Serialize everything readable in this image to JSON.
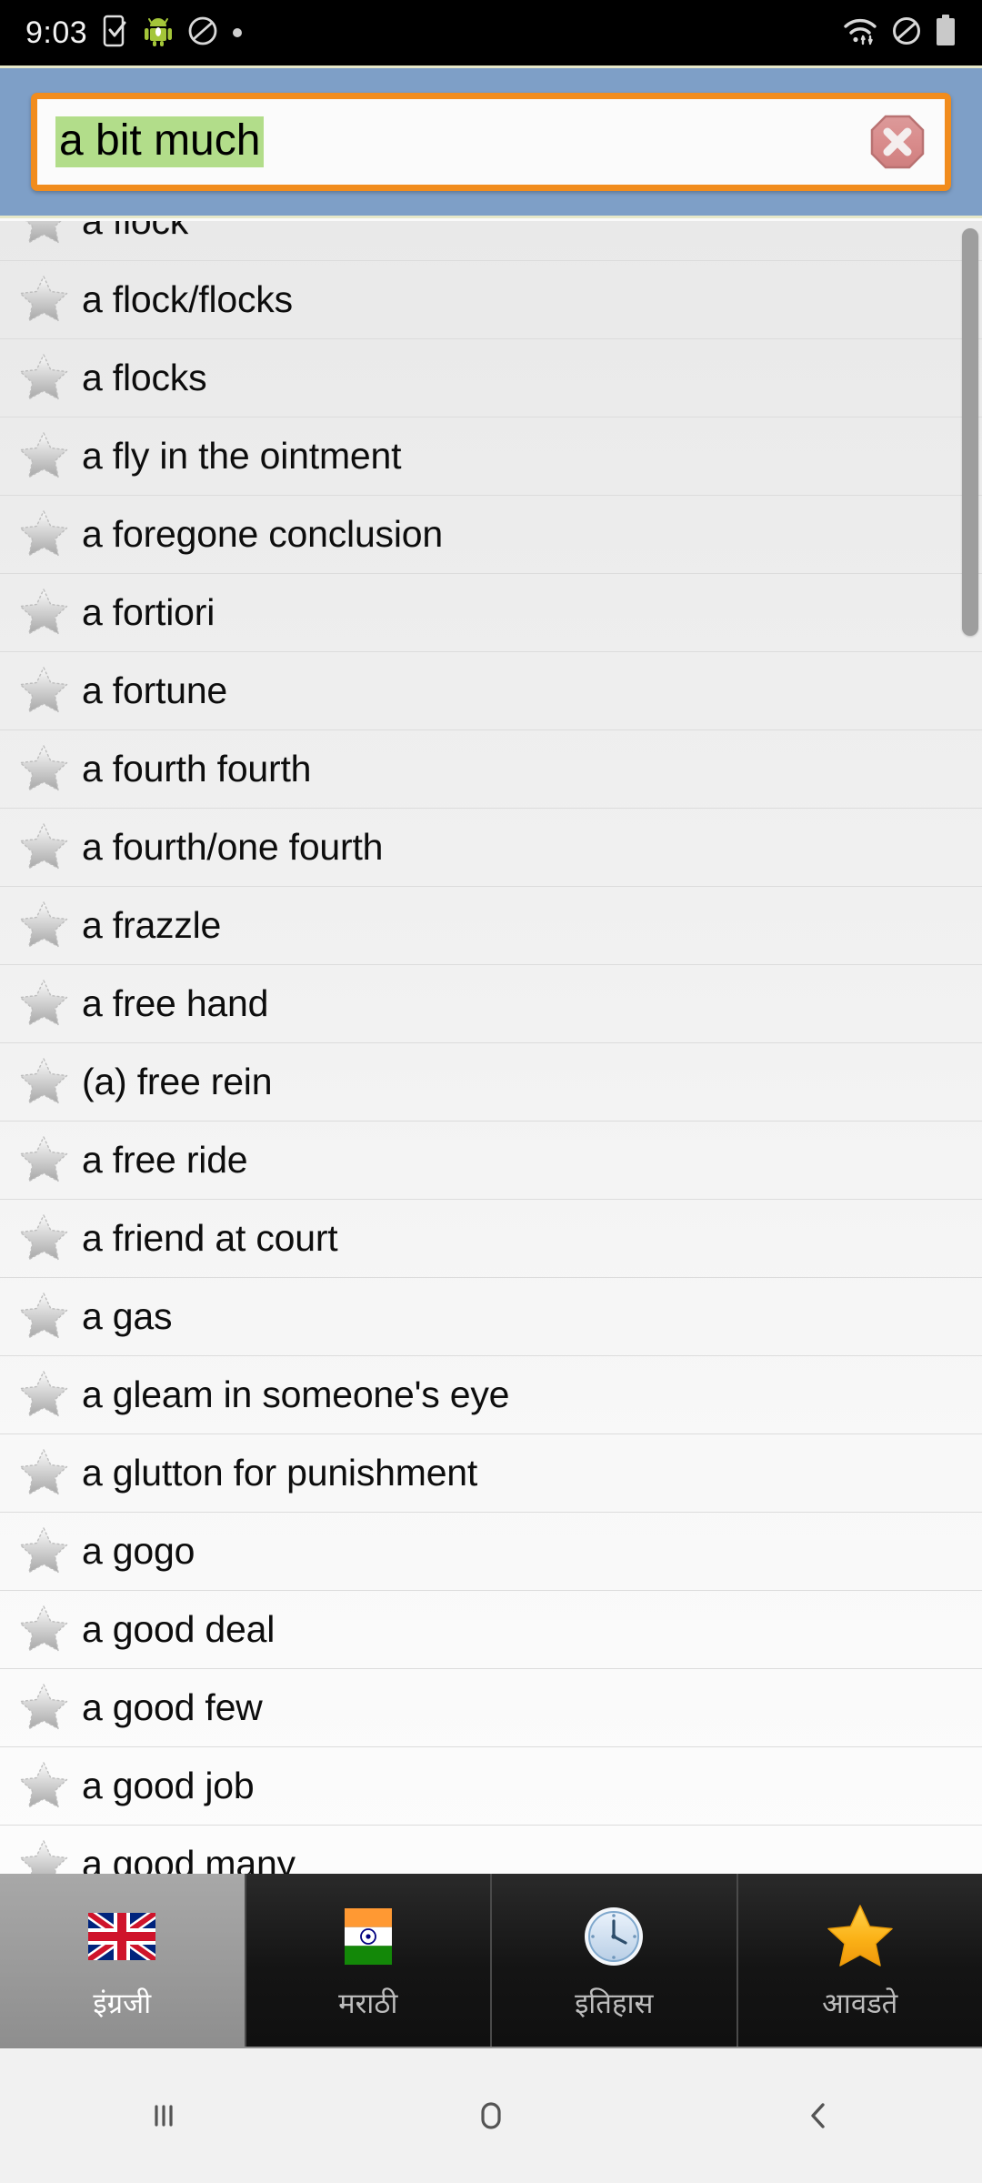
{
  "statusbar": {
    "time": "9:03",
    "icons": [
      "phone-check-icon",
      "android-robot-icon",
      "no-entry-icon",
      "dot-indicator-icon",
      "wifi-icon",
      "do-not-disturb-icon",
      "battery-icon"
    ]
  },
  "search": {
    "value": "a bit much",
    "placeholder": "",
    "clear_icon": "clear-octagon-icon",
    "highlight_color": "#b2dd8a",
    "border_color": "#f18c1d",
    "header_color": "#7e9fc7"
  },
  "list": {
    "star_icon": "star-outline-icon",
    "items": [
      {
        "label": "a flock"
      },
      {
        "label": "a flock/flocks"
      },
      {
        "label": "a flocks"
      },
      {
        "label": "a fly in the ointment"
      },
      {
        "label": "a foregone conclusion"
      },
      {
        "label": "a fortiori"
      },
      {
        "label": "a fortune"
      },
      {
        "label": "a fourth fourth"
      },
      {
        "label": "a fourth/one fourth"
      },
      {
        "label": "a frazzle"
      },
      {
        "label": "a free hand"
      },
      {
        "label": "(a) free rein"
      },
      {
        "label": "a free ride"
      },
      {
        "label": "a friend at court"
      },
      {
        "label": "a gas"
      },
      {
        "label": "a gleam in someone's eye"
      },
      {
        "label": "a glutton for punishment"
      },
      {
        "label": "a gogo"
      },
      {
        "label": "a good deal"
      },
      {
        "label": "a good few"
      },
      {
        "label": "a good job"
      },
      {
        "label": "a good many"
      }
    ]
  },
  "tabs": [
    {
      "label": "इंग्रजी",
      "icon": "uk-flag-icon",
      "selected": true
    },
    {
      "label": "मराठी",
      "icon": "india-flag-icon",
      "selected": false
    },
    {
      "label": "इतिहास",
      "icon": "clock-icon",
      "selected": false
    },
    {
      "label": "आवडते",
      "icon": "gold-star-icon",
      "selected": false
    }
  ],
  "navbar": {
    "recents_label": "recent-apps",
    "home_label": "home",
    "back_label": "back"
  }
}
